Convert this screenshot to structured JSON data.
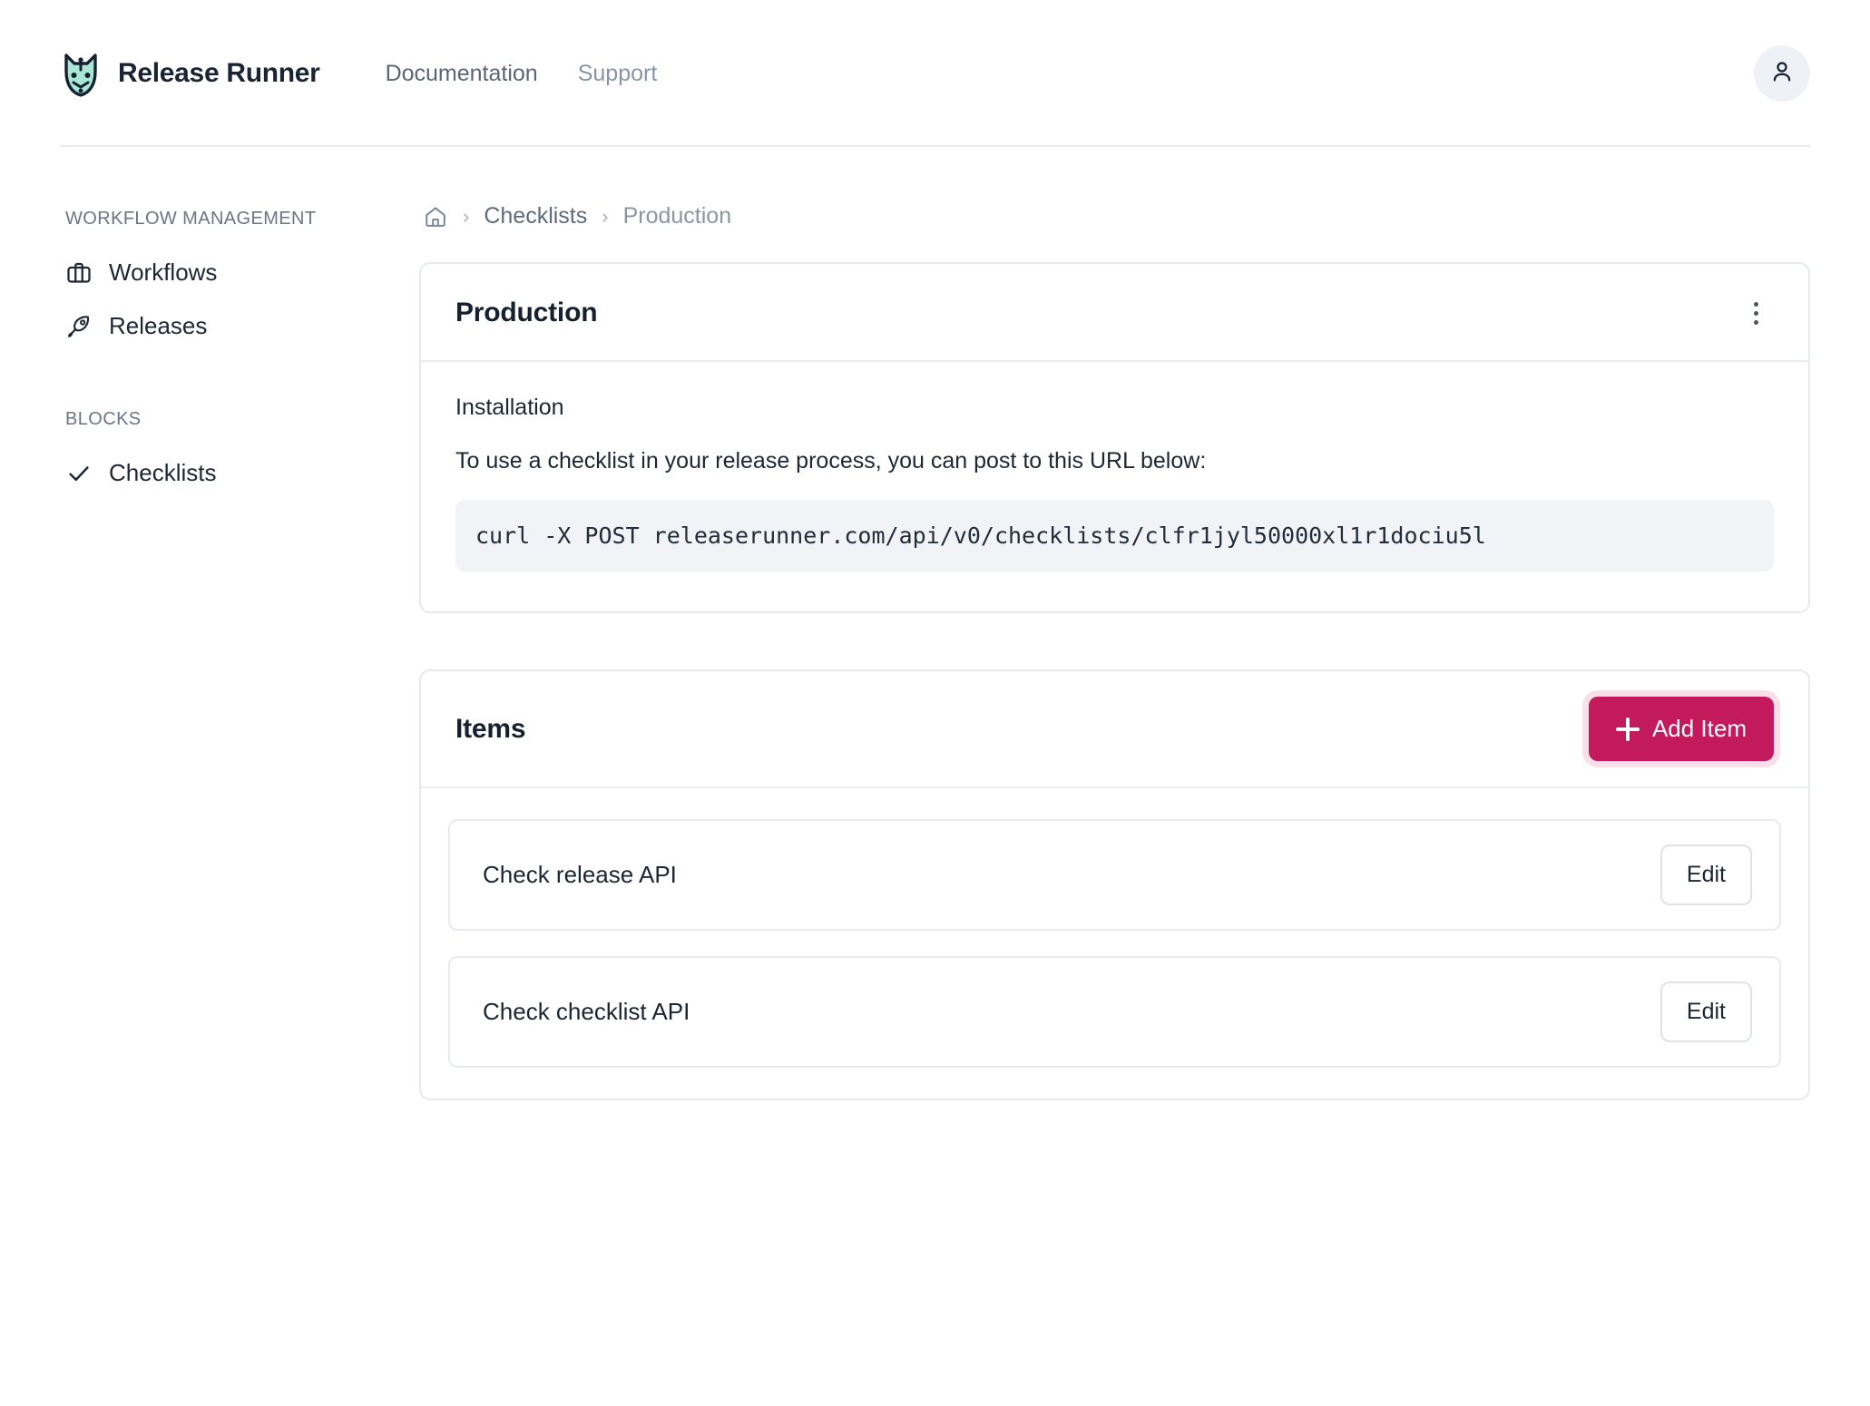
{
  "header": {
    "brand_name": "Release Runner",
    "logo_icon": "dog-head-logo-icon",
    "nav": [
      {
        "label": "Documentation",
        "icon": ""
      },
      {
        "label": "Support",
        "icon": ""
      }
    ],
    "avatar_icon": "user-icon"
  },
  "sidebar": {
    "groups": [
      {
        "title": "WORKFLOW MANAGEMENT",
        "items": [
          {
            "label": "Workflows",
            "icon": "briefcase-icon"
          },
          {
            "label": "Releases",
            "icon": "rocket-icon"
          }
        ]
      },
      {
        "title": "BLOCKS",
        "items": [
          {
            "label": "Checklists",
            "icon": "check-icon"
          }
        ]
      }
    ]
  },
  "breadcrumb": {
    "home_icon": "home-icon",
    "separator": "›",
    "items": [
      {
        "label": "Checklists"
      },
      {
        "label": "Production"
      }
    ]
  },
  "detail_card": {
    "title": "Production",
    "menu_icon": "kebab-menu-icon",
    "section_title": "Installation",
    "section_text": "To use a checklist in your release process, you can post to this URL below:",
    "code": "curl -X POST releaserunner.com/api/v0/checklists/clfr1jyl50000xl1r1dociu5l"
  },
  "items_card": {
    "title": "Items",
    "add_button_label": "Add Item",
    "add_button_icon": "plus-icon",
    "rows": [
      {
        "label": "Check release API",
        "action_label": "Edit"
      },
      {
        "label": "Check checklist API",
        "action_label": "Edit"
      }
    ]
  },
  "colors": {
    "accent": "#c31a5e",
    "accent_ring": "#fadfe9",
    "logo_fill": "#a8e6d6",
    "text_primary": "#1e2532",
    "text_muted": "#8a94a4",
    "border": "#e6e9ee",
    "code_bg": "#f1f3f7"
  }
}
